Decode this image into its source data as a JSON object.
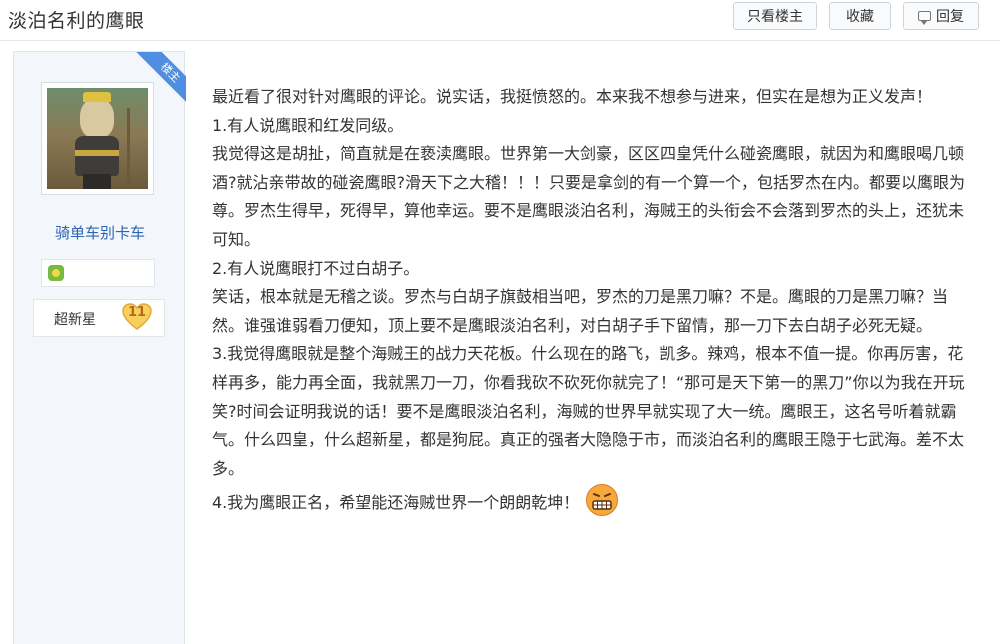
{
  "thread": {
    "title": "淡泊名利的鹰眼"
  },
  "toolbar": {
    "only_op_label": "只看楼主",
    "favorite_label": "收藏",
    "reply_label": "回复"
  },
  "author": {
    "ribbon": "楼主",
    "username": "骑单车别卡车",
    "rank_label": "超新星",
    "rank_level": "11"
  },
  "post": {
    "paragraphs": [
      "最近看了很对针对鹰眼的评论。说实话，我挺愤怒的。本来我不想参与进来，但实在是想为正义发声！",
      "1.有人说鹰眼和红发同级。",
      "我觉得这是胡扯，简直就是在亵渎鹰眼。世界第一大剑豪，区区四皇凭什么碰瓷鹰眼，就因为和鹰眼喝几顿酒?就沾亲带故的碰瓷鹰眼?滑天下之大稽！！！只要是拿剑的有一个算一个，包括罗杰在内。都要以鹰眼为尊。罗杰生得早，死得早，算他幸运。要不是鹰眼淡泊名利，海贼王的头衔会不会落到罗杰的头上，还犹未可知。",
      "2.有人说鹰眼打不过白胡子。",
      "笑话，根本就是无稽之谈。罗杰与白胡子旗鼓相当吧，罗杰的刀是黑刀嘛？不是。鹰眼的刀是黑刀嘛？当然。谁强谁弱看刀便知，顶上要不是鹰眼淡泊名利，对白胡子手下留情，那一刀下去白胡子必死无疑。",
      "3.我觉得鹰眼就是整个海贼王的战力天花板。什么现在的路飞，凯多。辣鸡，根本不值一提。你再厉害，花样再多，能力再全面，我就黑刀一刀，你看我砍不砍死你就完了！“那可是天下第一的黑刀”你以为我在开玩笑?时间会证明我说的话！要不是鹰眼淡泊名利，海贼的世界早就实现了大一统。鹰眼王，这名号听着就霸气。什么四皇，什么超新星，都是狗屁。真正的强者大隐隐于市，而淡泊名利的鹰眼王隐于七武海。差不太多。",
      "4.我为鹰眼正名，希望能还海贼世界一个朗朗乾坤！"
    ]
  },
  "icons": {
    "reply": "speech-bubble-icon",
    "badge": "medal-icon",
    "rank": "heart-rank-icon",
    "emoji": "grimace-emoji-icon"
  },
  "colors": {
    "link": "#2d64b3",
    "ribbon": "#4f8ee0",
    "sidebar_bg": "#f3f6fb"
  }
}
